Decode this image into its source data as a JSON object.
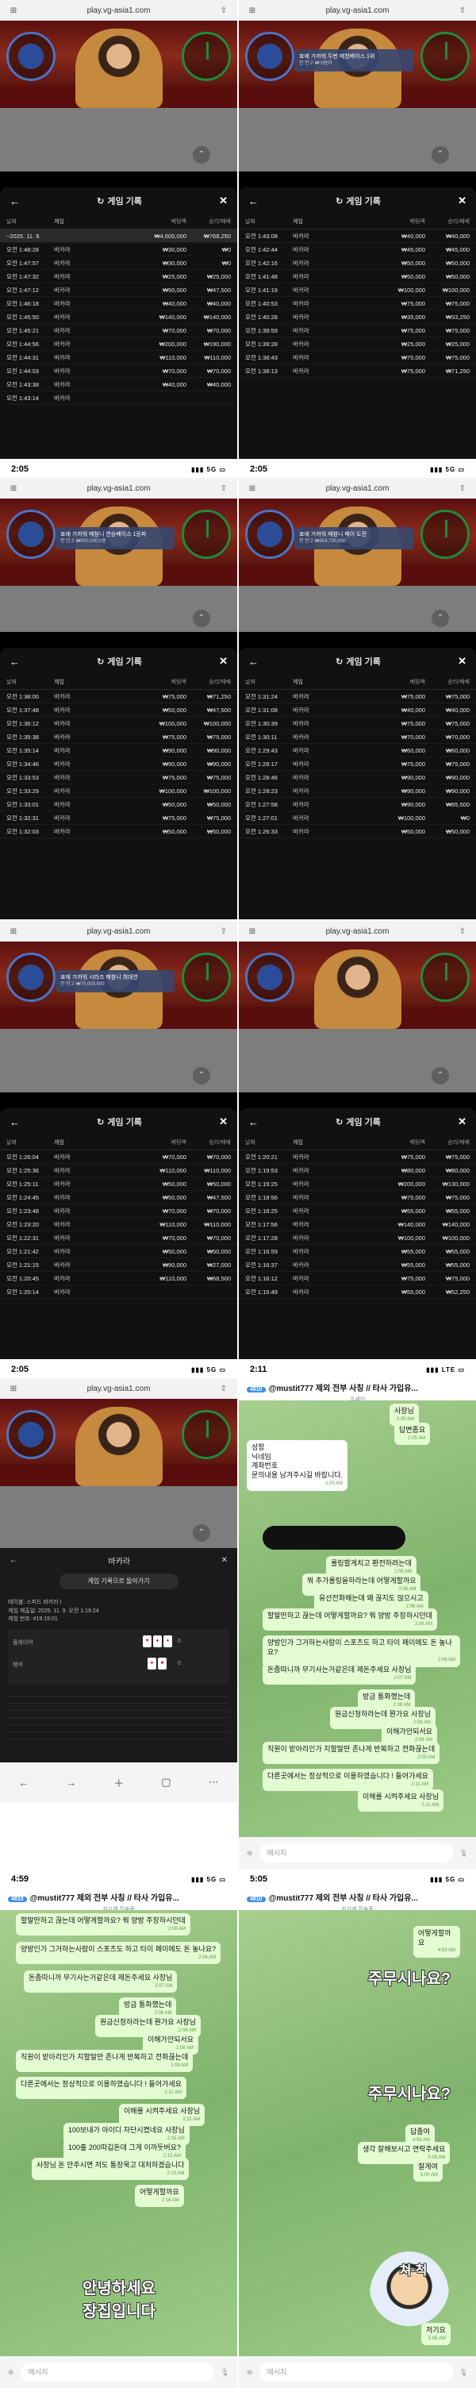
{
  "browser": {
    "url": "play.vg-asia1.com"
  },
  "status_times": [
    "2:05",
    "2:05",
    "2:11",
    "4:59",
    "5:05"
  ],
  "network": "5G",
  "network_lte": "LTE",
  "record_title": "게임 기록",
  "columns": {
    "date": "날짜",
    "game": "게임",
    "bet": "베팅액",
    "win": "승리/패배"
  },
  "game_name": "바카라",
  "panels": [
    {
      "toast": "",
      "toast_sub": "",
      "first_row": {
        "time": "~2025. 11. 9.",
        "bet": "₩4,600,000",
        "win": "₩768,250"
      },
      "rows": [
        [
          "오전 1:48:28",
          "₩30,000",
          "₩0"
        ],
        [
          "오전 1:47:57",
          "₩30,000",
          "₩0"
        ],
        [
          "오전 1:47:32",
          "₩25,000",
          "₩25,000"
        ],
        [
          "오전 1:47:12",
          "₩50,000",
          "₩47,500"
        ],
        [
          "오전 1:46:18",
          "₩40,000",
          "₩40,000"
        ],
        [
          "오전 1:45:50",
          "₩140,000",
          "₩140,000"
        ],
        [
          "오전 1:45:21",
          "₩70,000",
          "₩70,000"
        ],
        [
          "오전 1:44:56",
          "₩200,000",
          "₩190,000"
        ],
        [
          "오전 1:44:31",
          "₩110,000",
          "₩110,000"
        ],
        [
          "오전 1:44:03",
          "₩70,000",
          "₩70,000"
        ],
        [
          "오전 1:43:38",
          "₩40,000",
          "₩40,000"
        ],
        [
          "오전 1:43:14",
          "",
          ""
        ]
      ]
    },
    {
      "toast": "표에 가까워 두번 메찼베이스 1위",
      "toast_sub": "한 안고 ₩ 0원이",
      "rows": [
        [
          "오전 1:43:08",
          "₩40,000",
          "₩40,000"
        ],
        [
          "오전 1:42:44",
          "₩45,000",
          "₩45,000"
        ],
        [
          "오전 1:42:16",
          "₩50,000",
          "₩50,000"
        ],
        [
          "오전 1:41:48",
          "₩50,000",
          "₩50,000"
        ],
        [
          "오전 1:41:19",
          "₩100,000",
          "₩100,000"
        ],
        [
          "오전 1:40:53",
          "₩75,000",
          "₩75,000"
        ],
        [
          "오전 1:40:28",
          "₩35,000",
          "₩33,250"
        ],
        [
          "오전 1:39:59",
          "₩75,000",
          "₩75,000"
        ],
        [
          "오전 1:39:28",
          "₩25,000",
          "₩25,000"
        ],
        [
          "오전 1:38:43",
          "₩75,000",
          "₩75,000"
        ],
        [
          "오전 1:38:13",
          "₩75,000",
          "₩71,250"
        ]
      ]
    },
    {
      "toast": "표에 가까워 메참니 연승베이스 1등파",
      "toast_sub": "한 안고 ₩000,000,0원",
      "rows": [
        [
          "오전 1:38:00",
          "₩75,000",
          "₩71,250"
        ],
        [
          "오전 1:37:48",
          "₩50,000",
          "₩47,500"
        ],
        [
          "오전 1:36:12",
          "₩100,000",
          "₩100,000"
        ],
        [
          "오전 1:35:38",
          "₩75,000",
          "₩75,000"
        ],
        [
          "오전 1:35:14",
          "₩90,000",
          "₩90,000"
        ],
        [
          "오전 1:34:46",
          "₩90,000",
          "₩90,000"
        ],
        [
          "오전 1:33:53",
          "₩75,000",
          "₩75,000"
        ],
        [
          "오전 1:33:29",
          "₩100,000",
          "₩100,000"
        ],
        [
          "오전 1:33:01",
          "₩50,000",
          "₩50,000"
        ],
        [
          "오전 1:32:31",
          "₩75,000",
          "₩75,000"
        ],
        [
          "오전 1:32:03",
          "₩50,000",
          "₩50,000"
        ]
      ]
    },
    {
      "toast": "표에 가까워 메참니 메이 도전",
      "toast_sub": "한 안고 ₩304,700,000",
      "rows": [
        [
          "오전 1:31:24",
          "₩75,000",
          "₩75,000"
        ],
        [
          "오전 1:31:08",
          "₩40,000",
          "₩40,000"
        ],
        [
          "오전 1:30:39",
          "₩75,000",
          "₩75,000"
        ],
        [
          "오전 1:30:11",
          "₩70,000",
          "₩70,000"
        ],
        [
          "오전 1:29:43",
          "₩60,000",
          "₩60,000"
        ],
        [
          "오전 1:29:17",
          "₩75,000",
          "₩75,000"
        ],
        [
          "오전 1:28:46",
          "₩90,000",
          "₩90,000"
        ],
        [
          "오전 1:28:23",
          "₩90,000",
          "₩90,000"
        ],
        [
          "오전 1:27:58",
          "₩90,000",
          "₩85,500"
        ],
        [
          "오전 1:27:01",
          "₩100,000",
          "₩0"
        ],
        [
          "오전 1:26:33",
          "₩50,000",
          "₩50,000"
        ]
      ]
    },
    {
      "toast": "표에 가까워 시라즈 메참니 최대연",
      "toast_sub": "한 안고 ₩70,000,000",
      "rows": [
        [
          "오전 1:26:04",
          "₩70,000",
          "₩70,000"
        ],
        [
          "오전 1:25:36",
          "₩110,000",
          "₩110,000"
        ],
        [
          "오전 1:25:11",
          "₩50,000",
          "₩50,000"
        ],
        [
          "오전 1:24:45",
          "₩50,000",
          "₩47,500"
        ],
        [
          "오전 1:23:48",
          "₩70,000",
          "₩70,000"
        ],
        [
          "오전 1:23:20",
          "₩110,000",
          "₩110,000"
        ],
        [
          "오전 1:22:31",
          "₩70,000",
          "₩70,000"
        ],
        [
          "오전 1:21:42",
          "₩50,000",
          "₩50,000"
        ],
        [
          "오전 1:21:15",
          "₩90,000",
          "₩27,000"
        ],
        [
          "오전 1:20:45",
          "₩110,000",
          "₩68,500"
        ],
        [
          "오전 1:20:14",
          "",
          ""
        ]
      ]
    },
    {
      "toast": "",
      "toast_sub": "",
      "rows": [
        [
          "오전 1:20:21",
          "₩75,000",
          "₩75,000"
        ],
        [
          "오전 1:19:53",
          "₩80,000",
          "₩80,000"
        ],
        [
          "오전 1:19:25",
          "₩200,000",
          "₩130,000"
        ],
        [
          "오전 1:18:56",
          "₩75,000",
          "₩75,000"
        ],
        [
          "오전 1:18:25",
          "₩55,000",
          "₩55,000"
        ],
        [
          "오전 1:17:56",
          "₩140,000",
          "₩140,000"
        ],
        [
          "오전 1:17:28",
          "₩100,000",
          "₩100,000"
        ],
        [
          "오전 1:16:59",
          "₩55,000",
          "₩55,000"
        ],
        [
          "오전 1:16:37",
          "₩55,000",
          "₩55,000"
        ],
        [
          "오전 1:16:12",
          "₩75,000",
          "₩75,000"
        ],
        [
          "오전 1:15:49",
          "₩55,000",
          "₩52,250"
        ]
      ]
    }
  ],
  "baccarat": {
    "title": "바카라",
    "back_button": "게임 기록으로 돌아가기",
    "info": [
      "테이블: 스피드 바카라 I",
      "게임 제출일: 2025. 11. 9. 오전 1:19:24",
      "게임 번호: #19:19:01"
    ],
    "player_label": "플레이어",
    "banker_label": "뱅커",
    "player_score": "0",
    "banker_score": "0"
  },
  "chat1": {
    "title": "@mustit777 제외 전부 사칭 // 타사 가입유...",
    "badge": "4810",
    "subtitle": "온세인",
    "messages": [
      {
        "text": "사장님",
        "time": "2:05 AM"
      },
      {
        "text": "답변좀요",
        "time": "2:05 AM"
      },
      {
        "text": "성함\n닉네임\n계좌번호\n문의내용 남겨주시길 바랍니다.",
        "time": "2:05 AM",
        "white": true
      },
      {
        "text": "롤링할게치고 환전하려는데",
        "time": "2:06 AM"
      },
      {
        "text": "뭐 추가롤링을하라는데 어떻게할까요",
        "time": "2:06 AM"
      },
      {
        "text": "유선전화해는데 왜 끊지도 않으시고",
        "time": "2:06 AM"
      },
      {
        "text": "할말만하고 끊는데 어떻게할까요? 뭐 양방 주장하시던데",
        "time": "2:06 AM"
      },
      {
        "text": "양방인가 그거하는사람이 스포츠도 하고 타이 페이에도 돈 놓나요?",
        "time": "2:06 AM"
      },
      {
        "text": "돈좀따니까 무기사는거같은데 제돈주세요 사장님",
        "time": "2:07 AM"
      },
      {
        "text": "방금 통화했는데",
        "time": "2:08 AM"
      },
      {
        "text": "원금신청하라는데 뭔가요 사장님",
        "time": "2:08 AM"
      },
      {
        "text": "이해가안되서요",
        "time": "2:08 AM"
      },
      {
        "text": "직원이 받아리인가 지할말만 존나게 반복하고 전화끊는데",
        "time": "2:09 AM"
      },
      {
        "text": "다른곳에서는 정상적으로 이용하였습니다 ! 들어가세요",
        "time": "2:11 AM"
      },
      {
        "text": "이해를 시켜주세요 사장님",
        "time": "2:11 AM"
      }
    ],
    "input_placeholder": "메시지"
  },
  "chat2": {
    "title": "@mustit777 제외 전부 사칭 // 타사 가입유...",
    "badge": "4810",
    "subtitle": "자기계 집속중",
    "messages": [
      {
        "text": "할말만하고 끊는데 어떻게할까요? 뭐 양방 주장하시던데",
        "time": "2:06 AM"
      },
      {
        "text": "양방인가 그거하는사람이 스포츠도 하고 타이 페이에도 돈 놓나요?",
        "time": "2:06 AM"
      },
      {
        "text": "돈좀따니까 무기사는거같은데 제돈주세요 사장님",
        "time": "2:07 AM"
      },
      {
        "text": "방금 통화했는데",
        "time": "2:08 AM"
      },
      {
        "text": "원금신청하라는데 뭔가요 사장님",
        "time": "2:08 AM"
      },
      {
        "text": "이해가안되서요",
        "time": "2:08 AM"
      },
      {
        "text": "직원이 받아리인가 지할말만 존나게 반복하고 전화끊는데",
        "time": "2:09 AM"
      },
      {
        "text": "다른곳에서는 정상적으로 이용하였습니다 ! 들어가세요",
        "time": "2:11 AM"
      },
      {
        "text": "이해를 시켜주세요 사장님",
        "time": "2:11 AM"
      },
      {
        "text": "100보내가 아이디 자단시켰네요 사장님",
        "time": "2:15 AM"
      },
      {
        "text": "100출 200따깁돈데 그게 이까듯버요?",
        "time": "2:15 AM"
      },
      {
        "text": "사장님 돈 안주시면 저도 통장묵고 대처하겠습니다",
        "time": "2:15 AM"
      },
      {
        "text": "어떻게할까요",
        "time": "2:16 AM"
      }
    ],
    "big_text": "안녕하세요\n장집입니다",
    "input_placeholder": "메시지"
  },
  "chat3": {
    "title": "@mustit777 제외 전부 사칭 // 타사 가입유...",
    "badge": "4810",
    "subtitle": "자기계 집속중",
    "messages": [
      {
        "text": "어떻게할까요",
        "time": "4:59 AM"
      },
      {
        "text": "답좀여",
        "time": "4:59 AM"
      },
      {
        "text": "생각 잘해보시고 연락주세요",
        "time": "5:00 AM"
      },
      {
        "text": "잘게여",
        "time": "5:00 AM"
      },
      {
        "text": "저기요",
        "time": "5:05 AM"
      }
    ],
    "big1": "주무시나요?",
    "big2": "주무시나요?",
    "sticker_label": "쳐·척",
    "input_placeholder": "메시지"
  }
}
